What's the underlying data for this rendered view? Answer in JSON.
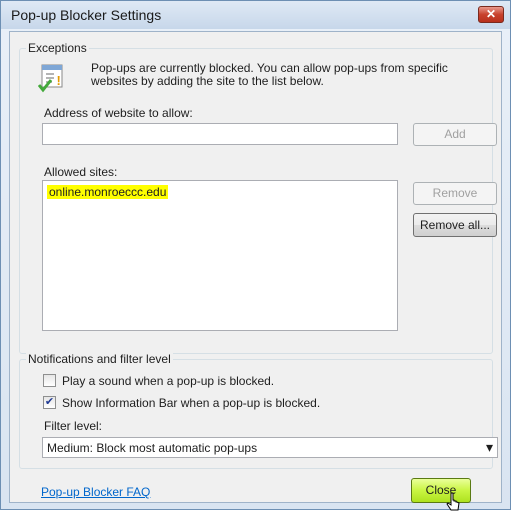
{
  "window": {
    "title": "Pop-up Blocker Settings",
    "close_glyph": "✕"
  },
  "exceptions": {
    "legend": "Exceptions",
    "info": "Pop-ups are currently blocked.  You can allow pop-ups from specific websites by adding the site to the list below.",
    "address_label": "Address of website to allow:",
    "address_value": "",
    "add_button": "Add",
    "allowed_label": "Allowed sites:",
    "allowed_sites": [
      "online.monroeccc.edu"
    ],
    "remove_button": "Remove",
    "remove_all_button": "Remove all..."
  },
  "notifications": {
    "legend": "Notifications and filter level",
    "play_sound": {
      "label": "Play a sound when a pop-up is blocked.",
      "checked": false
    },
    "show_info_bar": {
      "label": "Show Information Bar when a pop-up is blocked.",
      "checked": true
    },
    "filter_label": "Filter level:",
    "filter_value": "Medium: Block most automatic pop-ups"
  },
  "footer": {
    "faq_link": "Pop-up Blocker FAQ",
    "close_button": "Close"
  },
  "icons": {
    "info": "popup-blocker-icon",
    "check_mark": "✔",
    "dropdown_arrow": "▾"
  },
  "colors": {
    "highlight": "#ffff00",
    "close_button": "#c9f542",
    "link": "#0066cc"
  }
}
